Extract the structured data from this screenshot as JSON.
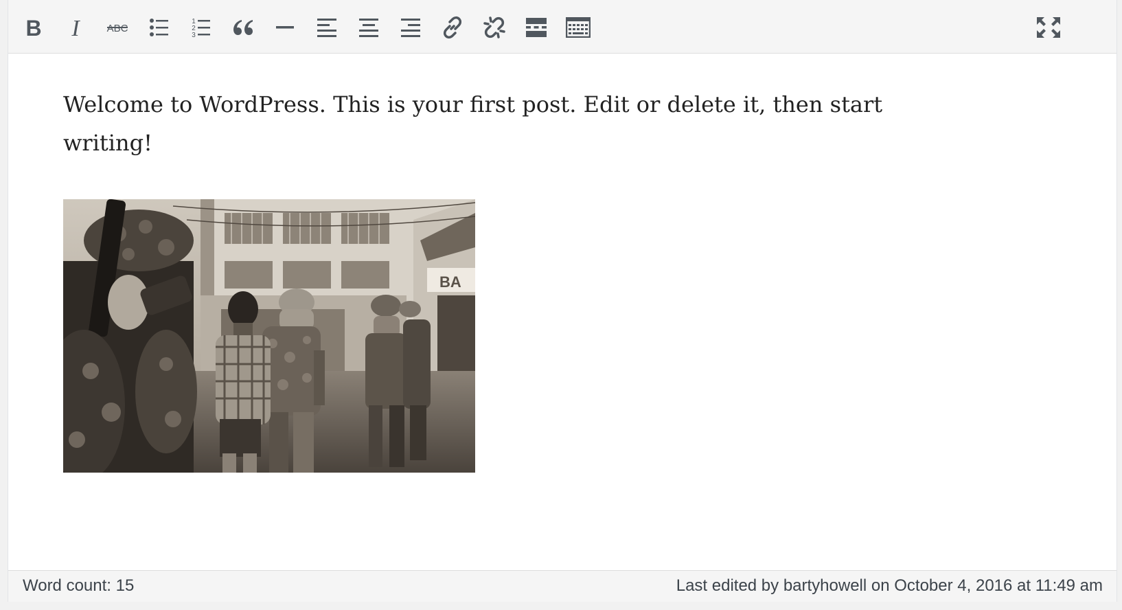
{
  "toolbar": {
    "buttons": [
      {
        "id": "bold",
        "icon": "bold-icon"
      },
      {
        "id": "italic",
        "icon": "italic-icon"
      },
      {
        "id": "strikethrough",
        "icon": "strikethrough-icon",
        "glyph": "ABC"
      },
      {
        "id": "bulleted-list",
        "icon": "bulleted-list-icon"
      },
      {
        "id": "numbered-list",
        "icon": "numbered-list-icon",
        "glyphs": [
          "1",
          "2",
          "3"
        ]
      },
      {
        "id": "blockquote",
        "icon": "blockquote-icon"
      },
      {
        "id": "horizontal-line",
        "icon": "horizontal-line-icon"
      },
      {
        "id": "align-left",
        "icon": "align-left-icon"
      },
      {
        "id": "align-center",
        "icon": "align-center-icon"
      },
      {
        "id": "align-right",
        "icon": "align-right-icon"
      },
      {
        "id": "insert-link",
        "icon": "link-icon"
      },
      {
        "id": "remove-link",
        "icon": "unlink-icon"
      },
      {
        "id": "read-more",
        "icon": "read-more-icon"
      },
      {
        "id": "toolbar-toggle",
        "icon": "kitchen-sink-icon"
      },
      {
        "id": "fullscreen",
        "icon": "fullscreen-icon"
      }
    ]
  },
  "content": {
    "paragraph": "Welcome to WordPress. This is your first post. Edit or delete it, then start writing!",
    "image": {
      "description": "Black and white photograph of soldiers escorting a man in a checked shirt down a street",
      "sign_text": "BA"
    }
  },
  "status": {
    "word_count": "Word count: 15",
    "last_edited": "Last edited by bartyhowell on October 4, 2016 at 11:49 am"
  },
  "colors": {
    "toolbar_bg": "#f5f5f5",
    "icon": "#50575e",
    "text": "#222222",
    "border": "#dddddd"
  }
}
